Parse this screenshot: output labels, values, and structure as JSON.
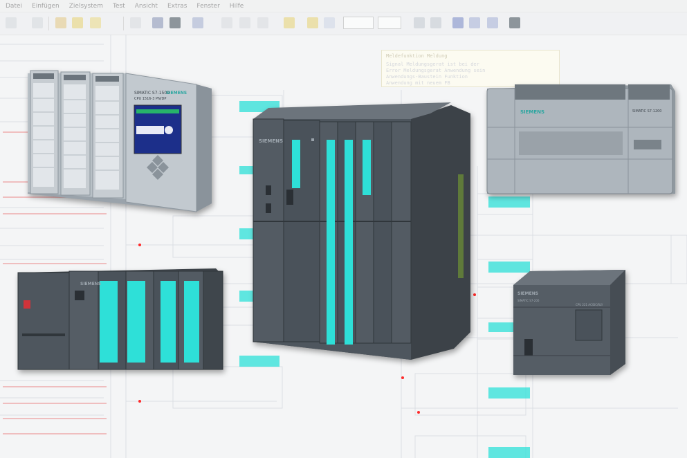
{
  "menu": {
    "items": [
      "Datei",
      "Einfügen",
      "Zielsystem",
      "Test",
      "Ansicht",
      "Extras",
      "Fenster",
      "Hilfe"
    ]
  },
  "toolbar": {
    "zoom_field": "",
    "offset_field": ""
  },
  "comment": {
    "title": "Meldefunktion Meldung",
    "lines": [
      "Signal Meldungsgerat ist bei der",
      "Error Meldungsgerat Anwendung sein",
      "Anwendungs-Baustein Funktion",
      "Anwendung mit neuem FB"
    ]
  },
  "plc": {
    "s7_1500_label": "SIMATIC S7-1500",
    "s7_1500_display": "CPU 1516-3 PN/DP",
    "s7_1500_brand": "SIEMENS",
    "s7_400_brand": "SIEMENS",
    "s7_300_brand": "SIEMENS",
    "s7_1200_brand": "SIEMENS",
    "s7_1200_label": "SIMATIC S7-1200",
    "s7_200_brand": "SIEMENS",
    "s7_200_label": "SIMATIC S7-200",
    "s7_200_cpu": "CPU 221 AC/DC/RLY"
  },
  "colors": {
    "cyan": "#2ee0d8",
    "module_dark": "#4e565e",
    "module_darker": "#3c4248",
    "siemens_teal": "#2aa6a0"
  }
}
